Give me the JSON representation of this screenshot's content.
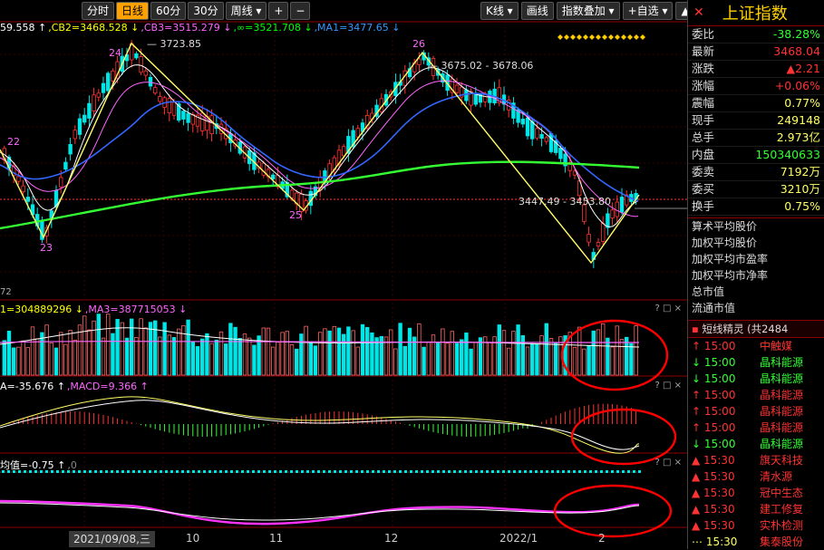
{
  "toolbar": {
    "buttons": [
      "分时",
      "日线",
      "60分",
      "30分",
      "周线 ▾",
      "+",
      "−"
    ],
    "right_buttons": [
      "K线 ▾",
      "画线",
      "指数叠加 ▾",
      "+自选 ▾",
      "▲"
    ]
  },
  "main_legend": [
    {
      "text": "59.558 ↑",
      "color": "#ffffff"
    },
    {
      "text": ",CB2=3468.528 ↓",
      "color": "#ffff00"
    },
    {
      "text": ",CB3=3515.279 ↓",
      "color": "#ff66ff"
    },
    {
      "text": ",∞=3521.708 ↓",
      "color": "#00ff00"
    },
    {
      "text": ",MA1=3477.65 ↓",
      "color": "#3399ff"
    }
  ],
  "annotations": {
    "peak1_price": "3723.85",
    "peak2_price": "3675.02 - 3678.06",
    "low_price": "3447.49 - 3453.80",
    "wave_labels": [
      "22",
      "23",
      "24",
      "25",
      "26"
    ],
    "bottom_left_label": "72"
  },
  "vol_legend": [
    {
      "text": "1=304889296 ↓",
      "color": "#ffff00"
    },
    {
      "text": ",MA3=387715053 ↓",
      "color": "#ff66ff"
    }
  ],
  "macd_legend": [
    {
      "text": "A=-35.676 ↑",
      "color": "#ffffff"
    },
    {
      "text": ",MACD=9.366 ↑",
      "color": "#ff66ff"
    }
  ],
  "avg_legend": [
    {
      "text": "均值=-0.75 ↑",
      "color": "#ffffff"
    },
    {
      "text": ",0",
      "color": "#888888"
    }
  ],
  "x_axis": {
    "date_box": "2021/09/08,三",
    "months": [
      "10",
      "11",
      "12",
      "2022/1",
      "2"
    ]
  },
  "pane_controls": "? □ ×",
  "panel": {
    "title": "上证指数",
    "title_color": "#ffd200",
    "quote_rows": [
      {
        "k": "委比",
        "v": "-38.28%",
        "c": "#33ff33"
      },
      {
        "k": "最新",
        "v": "3468.04",
        "c": "#ff3333"
      },
      {
        "k": "涨跌",
        "v": "▲2.21",
        "c": "#ff3333"
      },
      {
        "k": "涨幅",
        "v": "+0.06%",
        "c": "#ff3333"
      },
      {
        "k": "震幅",
        "v": "0.77%",
        "c": "#ffff66"
      },
      {
        "k": "现手",
        "v": "249148",
        "c": "#ffff66"
      },
      {
        "k": "总手",
        "v": "2.973亿",
        "c": "#ffff66"
      },
      {
        "k": "内盘",
        "v": "150340633",
        "c": "#33ff33"
      },
      {
        "k": "委卖",
        "v": "7192万",
        "c": "#ffff66"
      },
      {
        "k": "委买",
        "v": "3210万",
        "c": "#ffff66"
      },
      {
        "k": "换手",
        "v": "0.75%",
        "c": "#ffff66"
      }
    ],
    "text_list": [
      "算术平均股价",
      "加权平均股价",
      "加权平均市盈率",
      "加权平均市净率",
      "总市值",
      "流通市值"
    ],
    "genie_title": "短线精灵 (共2484",
    "trades": [
      {
        "arrow": "↑",
        "time": "15:00",
        "name": "中触媒",
        "ac": "#ff3333",
        "nc": "#ff3333"
      },
      {
        "arrow": "↓",
        "time": "15:00",
        "name": "晶科能源",
        "ac": "#33ff33",
        "nc": "#33ff33"
      },
      {
        "arrow": "↓",
        "time": "15:00",
        "name": "晶科能源",
        "ac": "#33ff33",
        "nc": "#33ff33"
      },
      {
        "arrow": "↑",
        "time": "15:00",
        "name": "晶科能源",
        "ac": "#ff3333",
        "nc": "#ff3333"
      },
      {
        "arrow": "↑",
        "time": "15:00",
        "name": "晶科能源",
        "ac": "#ff3333",
        "nc": "#ff3333"
      },
      {
        "arrow": "↑",
        "time": "15:00",
        "name": "晶科能源",
        "ac": "#ff3333",
        "nc": "#ff3333"
      },
      {
        "arrow": "↓",
        "time": "15:00",
        "name": "晶科能源",
        "ac": "#33ff33",
        "nc": "#33ff33"
      },
      {
        "arrow": "▲",
        "time": "15:30",
        "name": "旗天科技",
        "ac": "#ff3333",
        "nc": "#ff3333"
      },
      {
        "arrow": "▲",
        "time": "15:30",
        "name": "清水源",
        "ac": "#ff3333",
        "nc": "#ff3333"
      },
      {
        "arrow": "▲",
        "time": "15:30",
        "name": "冠中生态",
        "ac": "#ff3333",
        "nc": "#ff3333"
      },
      {
        "arrow": "▲",
        "time": "15:30",
        "name": "建工修复",
        "ac": "#ff3333",
        "nc": "#ff3333"
      },
      {
        "arrow": "▲",
        "time": "15:30",
        "name": "实朴检测",
        "ac": "#ff3333",
        "nc": "#ff3333"
      },
      {
        "arrow": "⋯",
        "time": "15:30",
        "name": "集泰股份",
        "ac": "#ffff66",
        "nc": "#ff3333"
      }
    ]
  }
}
